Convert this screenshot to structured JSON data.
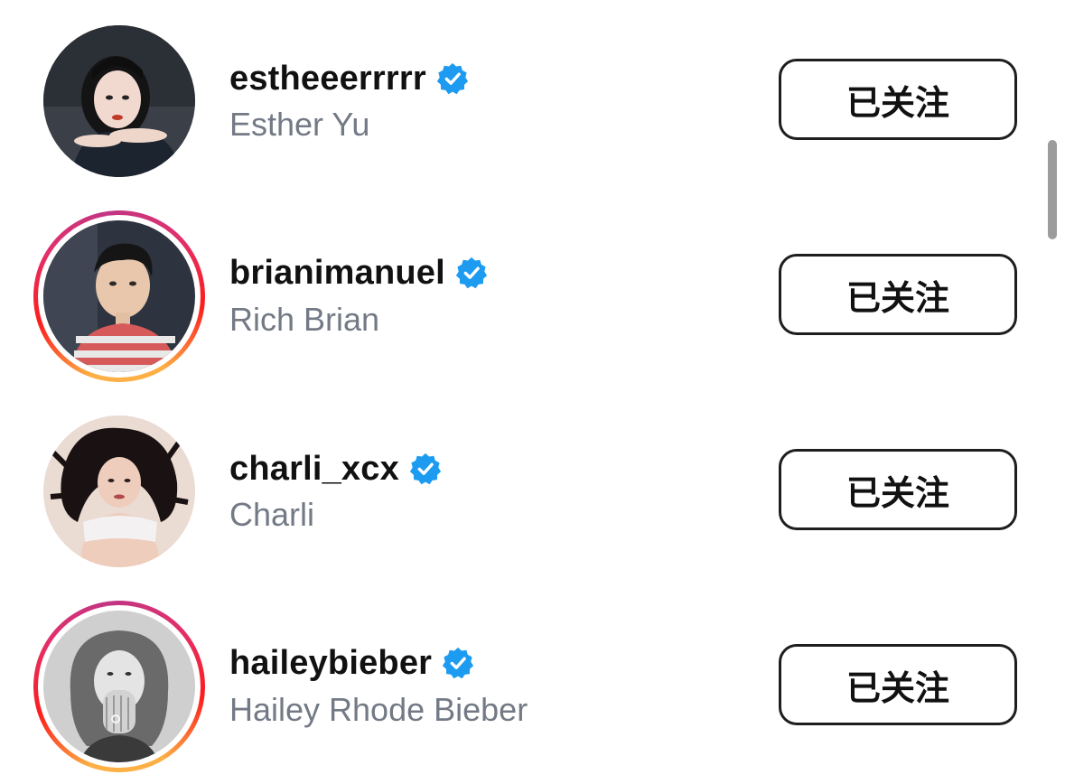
{
  "accounts": [
    {
      "username": "estheeerrrrr",
      "full_name": "Esther Yu",
      "verified": true,
      "story_ring": false,
      "avatar": "avatar-esther",
      "button_label": "已关注"
    },
    {
      "username": "brianimanuel",
      "full_name": "Rich Brian",
      "verified": true,
      "story_ring": true,
      "avatar": "avatar-brian",
      "button_label": "已关注"
    },
    {
      "username": "charli_xcx",
      "full_name": "Charli",
      "verified": true,
      "story_ring": false,
      "avatar": "avatar-charli",
      "button_label": "已关注"
    },
    {
      "username": "haileybieber",
      "full_name": "Hailey Rhode Bieber",
      "verified": true,
      "story_ring": true,
      "avatar": "avatar-hailey",
      "button_label": "已关注"
    }
  ],
  "icons": {
    "verified": "verified-badge-icon"
  },
  "colors": {
    "verified_blue": "#1d9bf0",
    "secondary_text": "#737a85",
    "primary_text": "#111111",
    "button_border": "#1e1e1e",
    "story_ring_gradient": [
      "#fcb045",
      "#fd1d1d",
      "#e1306c",
      "#c13584"
    ]
  }
}
